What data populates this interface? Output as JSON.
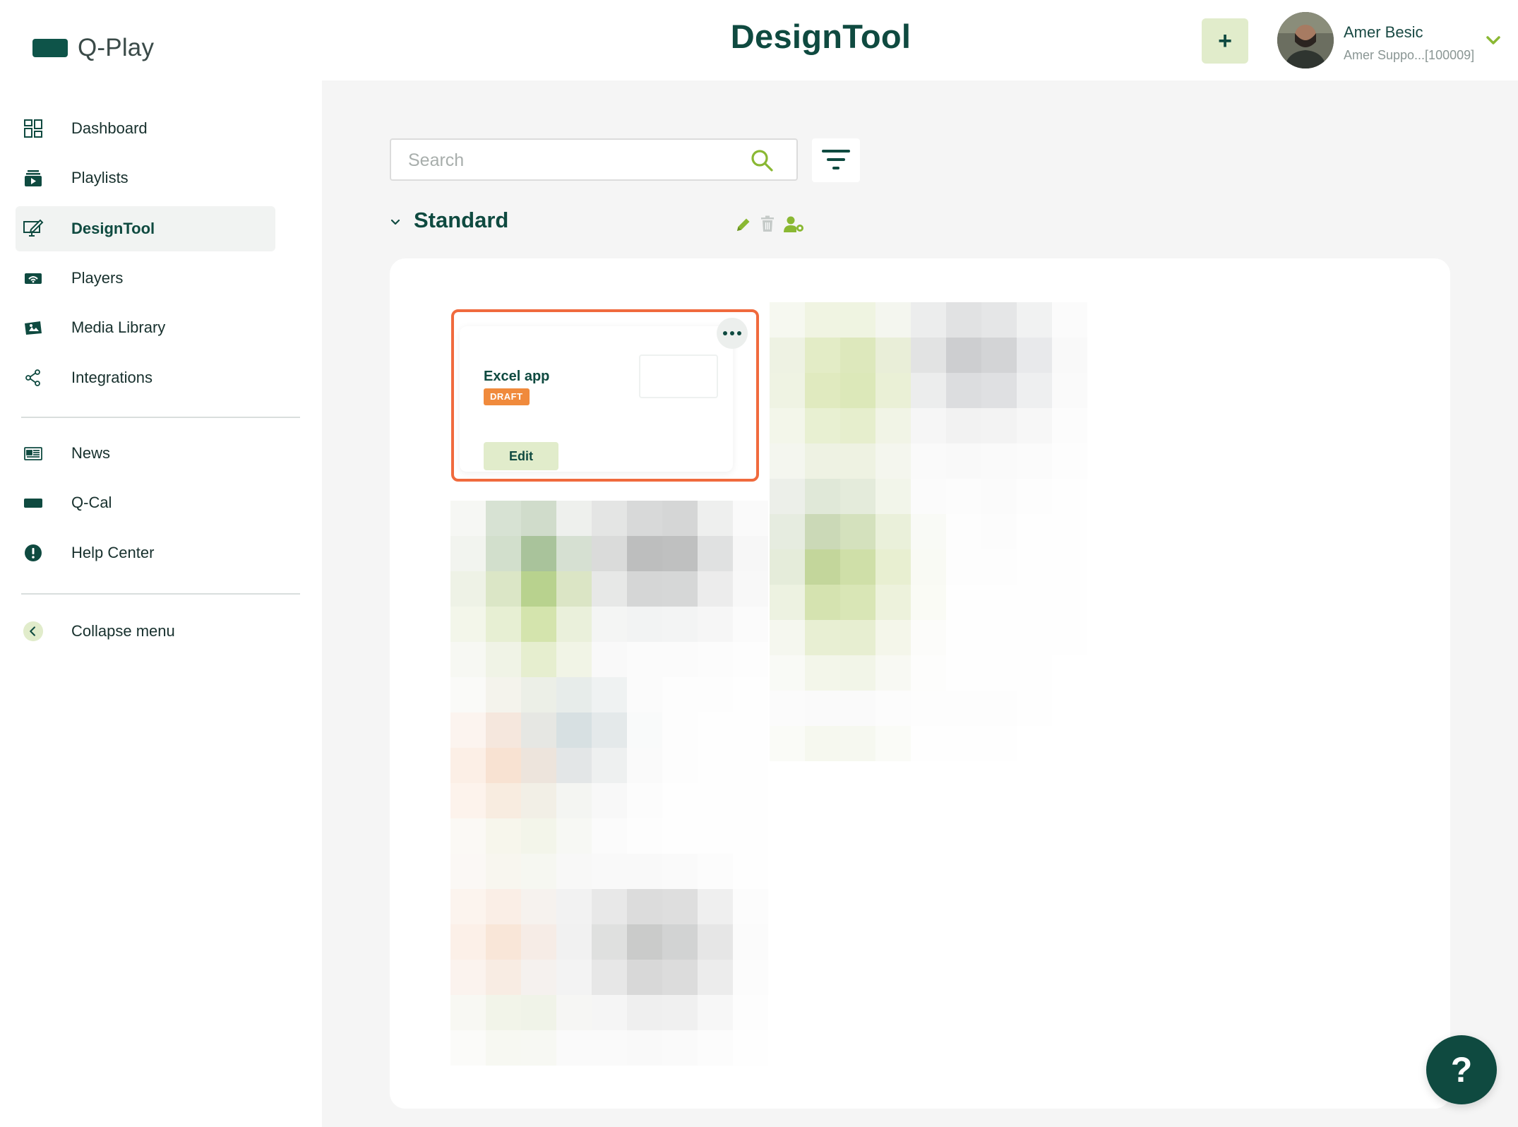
{
  "brand": {
    "name": "Q-Play",
    "color": "#0e5449"
  },
  "header": {
    "title": "DesignTool",
    "add_label": "+",
    "user_name": "Amer Besic",
    "user_sub": "Amer Suppo...[100009]"
  },
  "sidebar": {
    "items": [
      {
        "label": "Dashboard",
        "icon": "dashboard-icon"
      },
      {
        "label": "Playlists",
        "icon": "playlist-icon"
      },
      {
        "label": "DesignTool",
        "icon": "designtool-icon",
        "active": true
      },
      {
        "label": "Players",
        "icon": "player-icon"
      },
      {
        "label": "Media Library",
        "icon": "media-library-icon"
      },
      {
        "label": "Integrations",
        "icon": "integrations-icon"
      }
    ],
    "secondary": [
      {
        "label": "News",
        "icon": "news-icon"
      },
      {
        "label": "Q-Cal",
        "icon": "qcal-icon"
      },
      {
        "label": "Help Center",
        "icon": "help-center-icon"
      }
    ],
    "collapse_label": "Collapse menu"
  },
  "search": {
    "placeholder": "Search",
    "value": ""
  },
  "group": {
    "title": "Standard"
  },
  "card": {
    "name": "Excel app",
    "status": "DRAFT",
    "edit_label": "Edit"
  },
  "help": {
    "label": "?"
  },
  "colors": {
    "accent": "#0f4a40",
    "highlight": "#f06a3d",
    "lime": "#8ab833",
    "draft": "#f08a3c"
  }
}
